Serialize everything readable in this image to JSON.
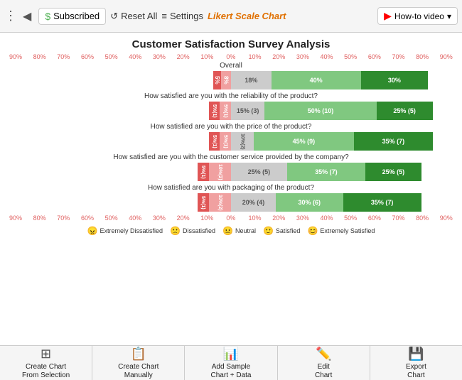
{
  "header": {
    "dots": "⋮",
    "back_label": "◀",
    "subscribed_label": "Subscribed",
    "reset_label": "Reset All",
    "settings_label": "Settings",
    "chart_link_label": "Likert Scale Chart",
    "howto_label": "How-to video"
  },
  "chart": {
    "title": "Customer Satisfaction Survey Analysis",
    "axis_labels": [
      "90%",
      "80%",
      "70%",
      "60%",
      "50%",
      "40%",
      "30%",
      "20%",
      "10%",
      "0%",
      "10%",
      "20%",
      "30%",
      "40%",
      "50%",
      "60%",
      "70%",
      "80%",
      "90%"
    ],
    "sections": [
      {
        "question": "Overall",
        "bars": {
          "ext_dis": "5%",
          "dis": "8%",
          "neu": "18%",
          "sat": "40%",
          "ext_sat": "30%",
          "ext_dis_w": 3.5,
          "dis_w": 4.5,
          "neu_w": 18,
          "sat_w": 40,
          "ext_sat_w": 30
        }
      },
      {
        "question": "How satisfied are you with the reliability of the product?",
        "bars": {
          "ext_dis": "5%(1)",
          "dis": "5%(1)",
          "neu": "15% (3)",
          "sat": "50% (10)",
          "ext_sat": "25% (5)",
          "ext_dis_w": 5,
          "dis_w": 5,
          "neu_w": 15,
          "sat_w": 50,
          "ext_sat_w": 25
        }
      },
      {
        "question": "How satisfied are you with the price of the product?",
        "bars": {
          "ext_dis": "5%(1)",
          "dis": "5%(1)",
          "neu": "10%(2)",
          "sat": "45% (9)",
          "ext_sat": "35% (7)",
          "ext_dis_w": 5,
          "dis_w": 5,
          "neu_w": 10,
          "sat_w": 45,
          "ext_sat_w": 35
        }
      },
      {
        "question": "How satisfied are you with the customer service provided by the company?",
        "bars": {
          "ext_dis": "5%(1)",
          "dis": "10%(2)",
          "neu": "25% (5)",
          "sat": "35% (7)",
          "ext_sat": "25% (5)",
          "ext_dis_w": 5,
          "dis_w": 10,
          "neu_w": 25,
          "sat_w": 35,
          "ext_sat_w": 25
        }
      },
      {
        "question": "How satisfied are you with packaging of the product?",
        "bars": {
          "ext_dis": "5%(1)",
          "dis": "10%(2)",
          "neu": "20% (4)",
          "sat": "30% (6)",
          "ext_sat": "35% (7)",
          "ext_dis_w": 5,
          "dis_w": 10,
          "neu_w": 20,
          "sat_w": 30,
          "ext_sat_w": 35
        }
      }
    ],
    "legend": [
      {
        "face": "😠",
        "label": "Extremely Dissatisfied"
      },
      {
        "face": "🙁",
        "label": "Dissatisfied"
      },
      {
        "face": "😐",
        "label": "Neutral"
      },
      {
        "face": "🙂",
        "label": "Satisfied"
      },
      {
        "face": "😊",
        "label": "Extremely Satisfied"
      }
    ]
  },
  "footer": {
    "buttons": [
      {
        "icon": "📊",
        "label": "Create Chart\nFrom Selection"
      },
      {
        "icon": "📋",
        "label": "Create Chart\nManually"
      },
      {
        "icon": "📈",
        "label": "Add Sample\nChart + Data"
      },
      {
        "icon": "✏️",
        "label": "Edit\nChart"
      },
      {
        "icon": "💾",
        "label": "Export\nChart"
      }
    ]
  }
}
